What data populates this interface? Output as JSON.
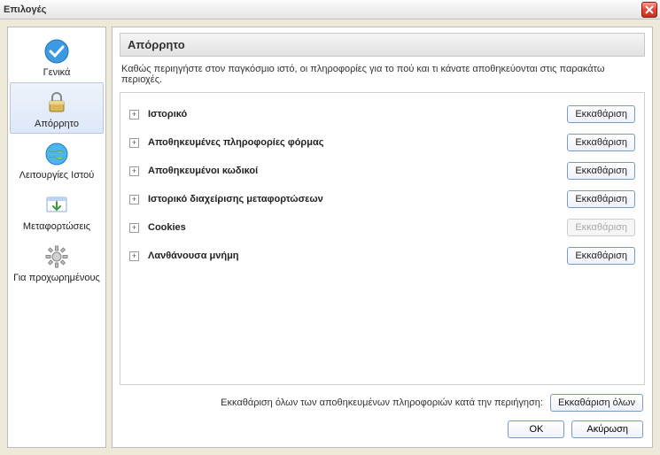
{
  "window": {
    "title": "Επιλογές"
  },
  "sidebar": {
    "items": [
      {
        "label": "Γενικά"
      },
      {
        "label": "Απόρρητο"
      },
      {
        "label": "Λειτουργίες Ιστού"
      },
      {
        "label": "Μεταφορτώσεις"
      },
      {
        "label": "Για προχωρημένους"
      }
    ]
  },
  "page": {
    "header": "Απόρρητο",
    "description": "Καθώς περιηγήστε στον παγκόσμιο ιστό, οι πληροφορίες για το πού και τι κάνατε αποθηκεύονται στις παρακάτω περιοχές."
  },
  "rows": [
    {
      "label": "Ιστορικό",
      "btn": "Εκκαθάριση",
      "disabled": false
    },
    {
      "label": "Αποθηκευμένες πληροφορίες φόρμας",
      "btn": "Εκκαθάριση",
      "disabled": false
    },
    {
      "label": "Αποθηκευμένοι κωδικοί",
      "btn": "Εκκαθάριση",
      "disabled": false
    },
    {
      "label": "Ιστορικό διαχείρισης μεταφορτώσεων",
      "btn": "Εκκαθάριση",
      "disabled": false
    },
    {
      "label": "Cookies",
      "btn": "Εκκαθάριση",
      "disabled": true
    },
    {
      "label": "Λανθάνουσα μνήμη",
      "btn": "Εκκαθάριση",
      "disabled": false
    }
  ],
  "footer": {
    "clear_all_label": "Εκκαθάριση όλων των αποθηκευμένων πληροφοριών κατά την περιήγηση:",
    "clear_all_btn": "Εκκαθάριση όλων",
    "ok": "OK",
    "cancel": "Ακύρωση"
  }
}
